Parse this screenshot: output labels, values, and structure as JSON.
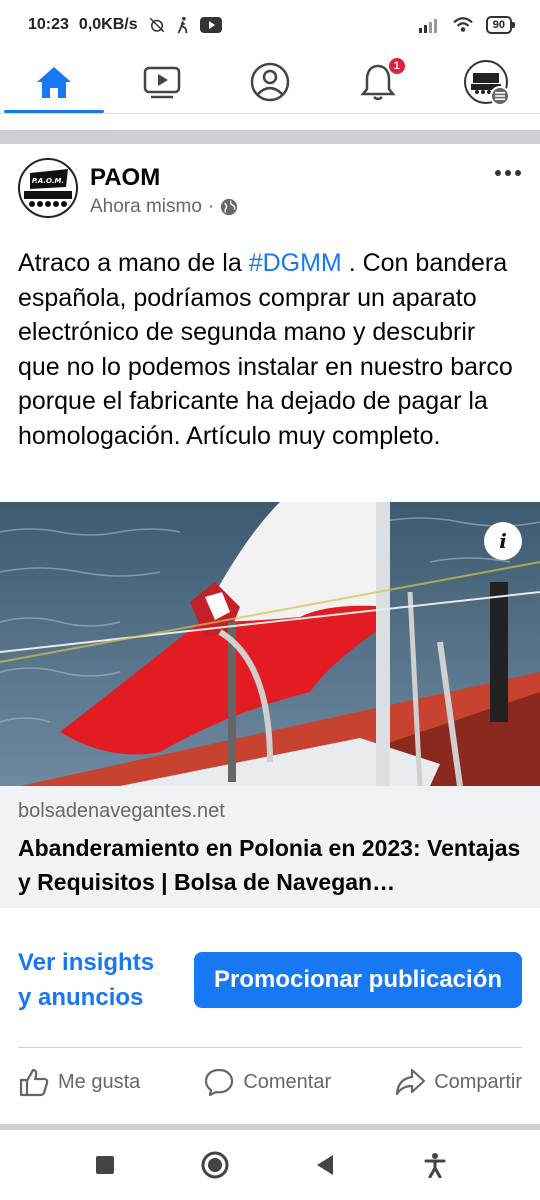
{
  "status_bar": {
    "time": "10:23",
    "speed": "0,0KB/s",
    "battery": "90"
  },
  "nav": {
    "tabs": [
      {
        "name": "home",
        "icon": "home-icon",
        "active": true
      },
      {
        "name": "watch",
        "icon": "video-icon",
        "active": false
      },
      {
        "name": "profile",
        "icon": "profile-icon",
        "active": false
      },
      {
        "name": "notifications",
        "icon": "bell-icon",
        "active": false,
        "badge": "1"
      },
      {
        "name": "menu",
        "icon": "page-avatar-icon",
        "active": false
      }
    ],
    "accent": "#1877f2"
  },
  "post": {
    "page_name": "PAOM",
    "avatar_text": "P.A.O.M.",
    "timestamp": "Ahora mismo",
    "separator": "·",
    "text_before": "Atraco a mano de la ",
    "hashtag": "#DGMM",
    "text_after": " . Con bandera española, podríamos comprar un aparato electrónico de segunda mano y descubrir que no lo podemos instalar en nuestro barco porque el fabricante ha dejado de pagar la homologación. Artículo muy completo.",
    "link": {
      "domain": "bolsadenavegantes.net",
      "title": "Abanderamiento en Polonia en 2023: Ventajas y Requisitos | Bolsa de Navegan…",
      "info_label": "i"
    },
    "insights_label": "Ver insights y anuncios",
    "promote_label": "Promocionar publicación",
    "reactions": {
      "like": "Me gusta",
      "comment": "Comentar",
      "share": "Compartir"
    }
  }
}
